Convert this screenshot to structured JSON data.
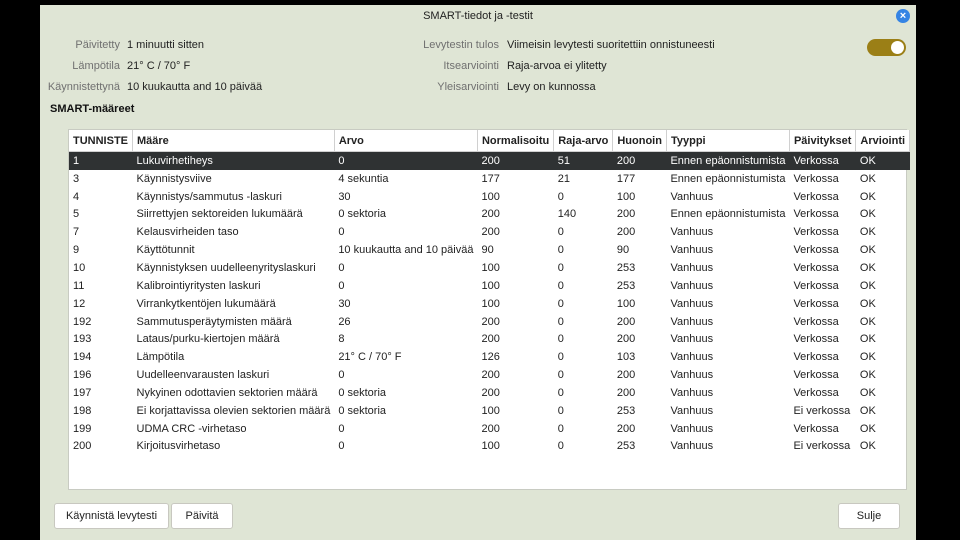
{
  "window": {
    "title": "SMART-tiedot ja -testit",
    "close_icon": "×"
  },
  "info_left": [
    {
      "label": "Päivitetty",
      "value": "1 minuutti sitten"
    },
    {
      "label": "Lämpötila",
      "value": "21° C / 70° F"
    },
    {
      "label": "Käynnistettynä",
      "value": "10 kuukautta and 10 päivää"
    }
  ],
  "info_right": [
    {
      "label": "Levytestin tulos",
      "value": "Viimeisin levytesti suoritettiin onnistuneesti"
    },
    {
      "label": "Itsearviointi",
      "value": "Raja-arvoa ei ylitetty"
    },
    {
      "label": "Yleisarviointi",
      "value": "Levy on kunnossa"
    }
  ],
  "smart_toggle": {
    "on": true,
    "accent": "#9b7f16"
  },
  "section_title": "SMART-määreet",
  "table": {
    "columns": [
      "TUNNISTE",
      "Määre",
      "Arvo",
      "Normalisoitu",
      "Raja-arvo",
      "Huonoin",
      "Tyyppi",
      "Päivitykset",
      "Arviointi"
    ],
    "selected_index": 0,
    "rows": [
      [
        "1",
        "Lukuvirhetiheys",
        "0",
        "200",
        "51",
        "200",
        "Ennen epäonnistumista",
        "Verkossa",
        "OK"
      ],
      [
        "3",
        "Käynnistysviive",
        "4 sekuntia",
        "177",
        "21",
        "177",
        "Ennen epäonnistumista",
        "Verkossa",
        "OK"
      ],
      [
        "4",
        "Käynnistys/sammutus -laskuri",
        "30",
        "100",
        "0",
        "100",
        "Vanhuus",
        "Verkossa",
        "OK"
      ],
      [
        "5",
        "Siirrettyjen sektoreiden lukumäärä",
        "0 sektoria",
        "200",
        "140",
        "200",
        "Ennen epäonnistumista",
        "Verkossa",
        "OK"
      ],
      [
        "7",
        "Kelausvirheiden taso",
        "0",
        "200",
        "0",
        "200",
        "Vanhuus",
        "Verkossa",
        "OK"
      ],
      [
        "9",
        "Käyttötunnit",
        "10 kuukautta and 10 päivää",
        "90",
        "0",
        "90",
        "Vanhuus",
        "Verkossa",
        "OK"
      ],
      [
        "10",
        "Käynnistyksen uudelleenyrityslaskuri",
        "0",
        "100",
        "0",
        "253",
        "Vanhuus",
        "Verkossa",
        "OK"
      ],
      [
        "11",
        "Kalibrointiyritysten laskuri",
        "0",
        "100",
        "0",
        "253",
        "Vanhuus",
        "Verkossa",
        "OK"
      ],
      [
        "12",
        "Virrankytkentöjen lukumäärä",
        "30",
        "100",
        "0",
        "100",
        "Vanhuus",
        "Verkossa",
        "OK"
      ],
      [
        "192",
        "Sammutusperäytymisten määrä",
        "26",
        "200",
        "0",
        "200",
        "Vanhuus",
        "Verkossa",
        "OK"
      ],
      [
        "193",
        "Lataus/purku-kiertojen määrä",
        "8",
        "200",
        "0",
        "200",
        "Vanhuus",
        "Verkossa",
        "OK"
      ],
      [
        "194",
        "Lämpötila",
        "21° C / 70° F",
        "126",
        "0",
        "103",
        "Vanhuus",
        "Verkossa",
        "OK"
      ],
      [
        "196",
        "Uudelleenvarausten laskuri",
        "0",
        "200",
        "0",
        "200",
        "Vanhuus",
        "Verkossa",
        "OK"
      ],
      [
        "197",
        "Nykyinen odottavien sektorien määrä",
        "0 sektoria",
        "200",
        "0",
        "200",
        "Vanhuus",
        "Verkossa",
        "OK"
      ],
      [
        "198",
        "Ei korjattavissa olevien sektorien määrä",
        "0 sektoria",
        "100",
        "0",
        "253",
        "Vanhuus",
        "Ei verkossa",
        "OK"
      ],
      [
        "199",
        "UDMA CRC -virhetaso",
        "0",
        "200",
        "0",
        "200",
        "Vanhuus",
        "Verkossa",
        "OK"
      ],
      [
        "200",
        "Kirjoitusvirhetaso",
        "0",
        "100",
        "0",
        "253",
        "Vanhuus",
        "Ei verkossa",
        "OK"
      ]
    ]
  },
  "buttons": {
    "start_test": "Käynnistä levytesti",
    "refresh": "Päivitä",
    "close": "Sulje"
  }
}
